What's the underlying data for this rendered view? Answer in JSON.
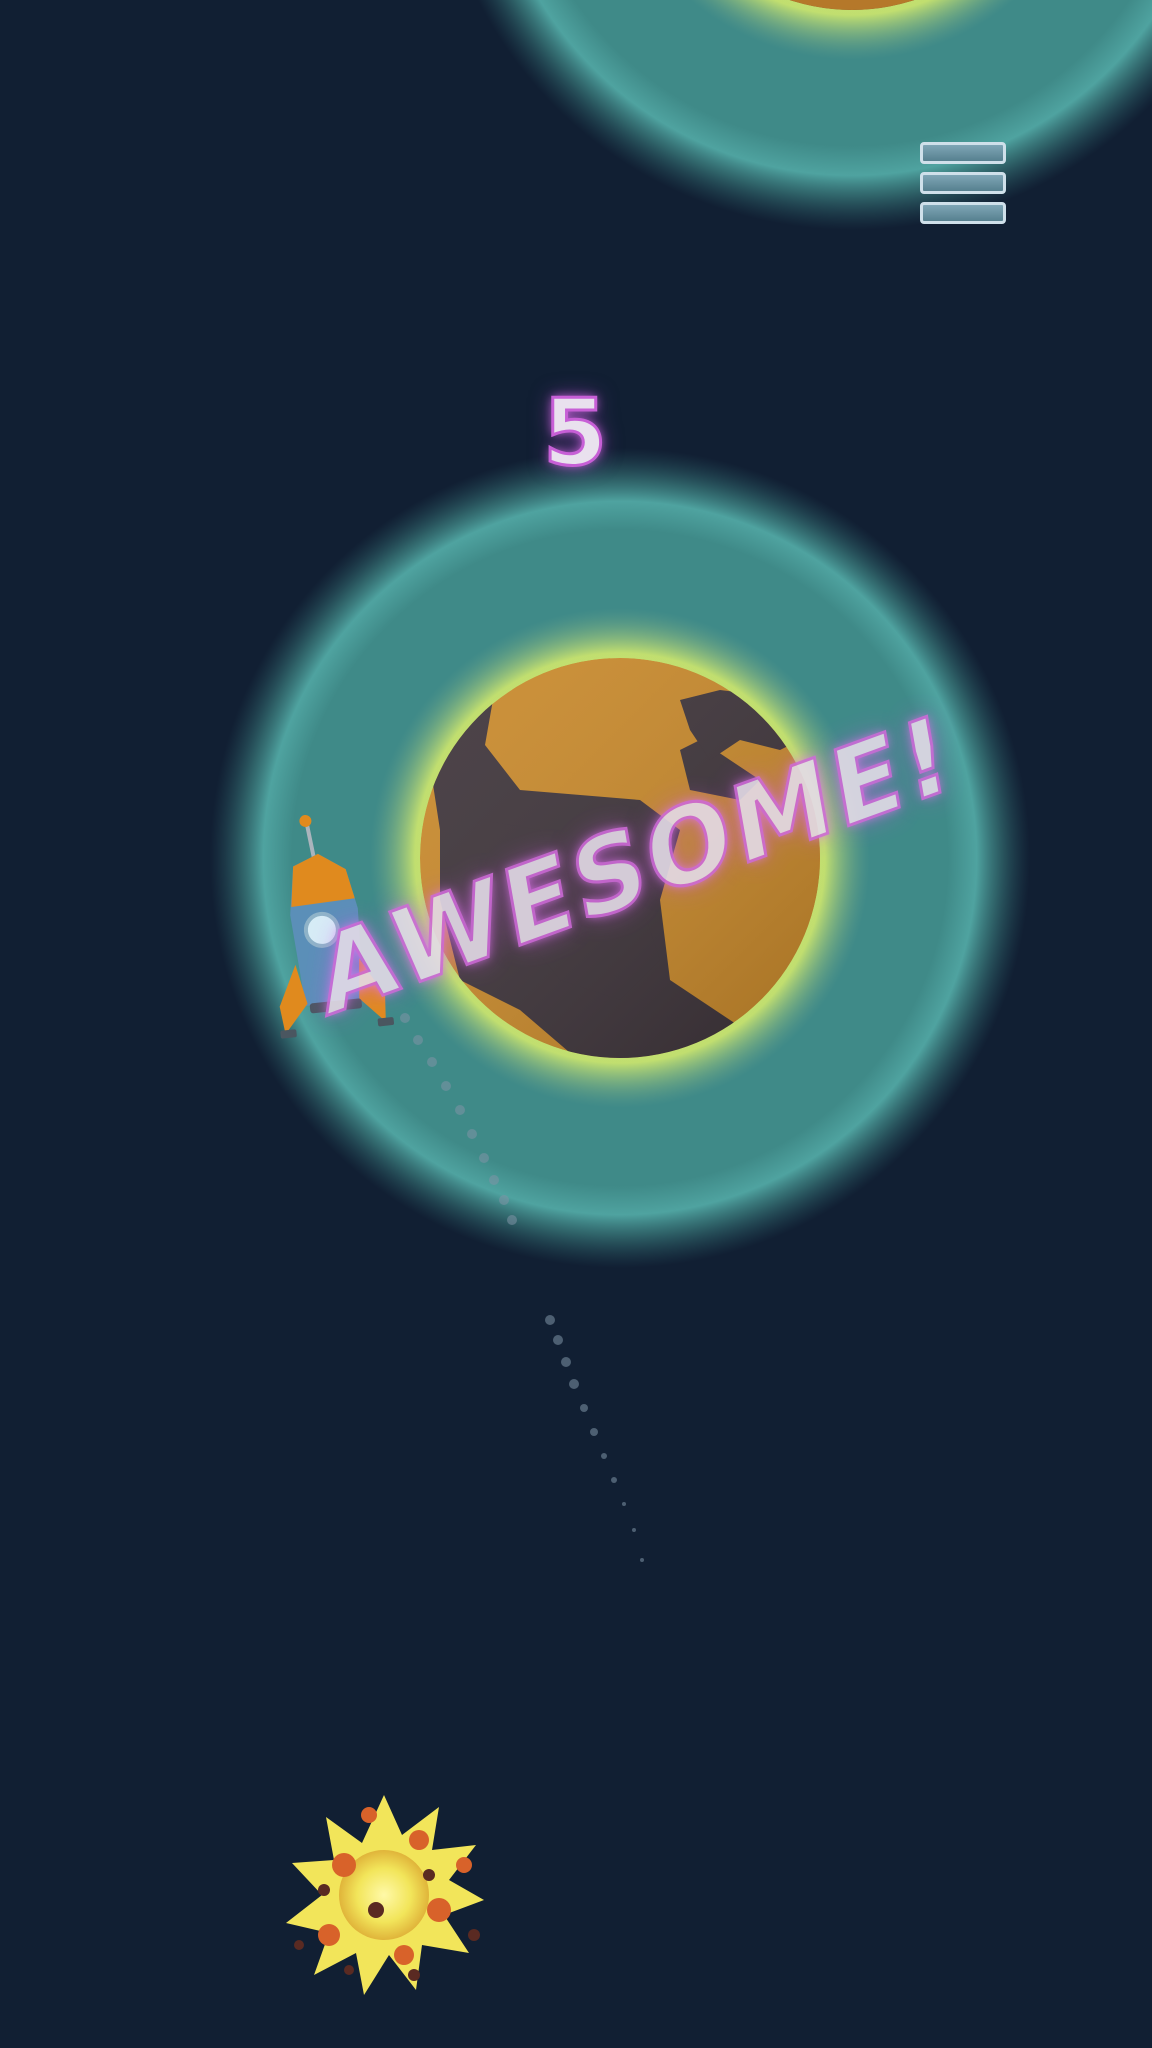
{
  "game": {
    "score": "5",
    "praise_text": "AWESOME!"
  },
  "colors": {
    "background": "#111f33",
    "orbit_ring": "#3f8c8c",
    "planet_glow": "#c8e36e",
    "planet_dark": "#3d3339",
    "planet_orange": "#c9892a",
    "text_fill": "#e9e1ee",
    "text_outline": "#c75fd6",
    "rocket_body": "#5b8fb8",
    "rocket_nose": "#e08a1e",
    "explosion": "#f4ec6a"
  },
  "icons": {
    "menu": "hamburger-menu-icon"
  }
}
